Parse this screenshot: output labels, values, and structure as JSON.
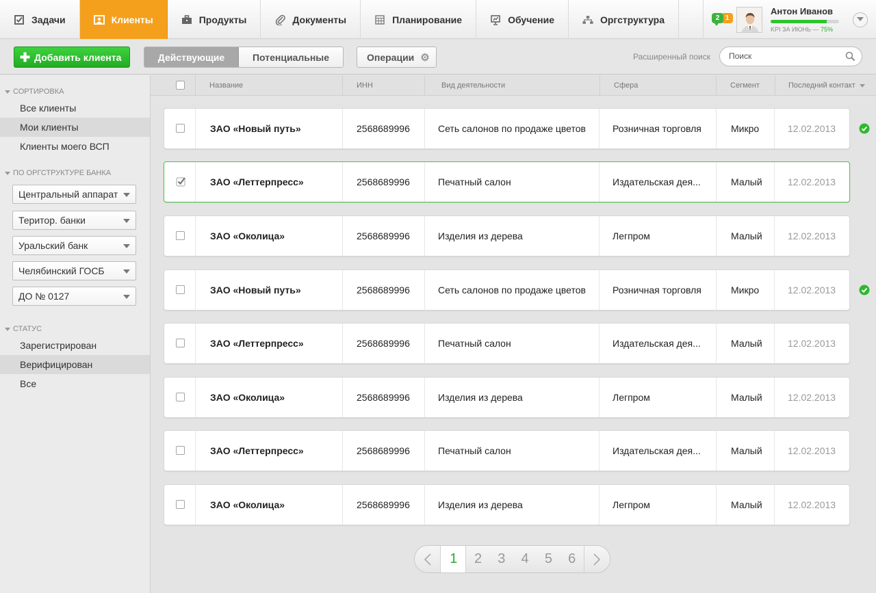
{
  "nav": {
    "tabs": [
      {
        "label": "Задачи",
        "icon": "checkbox-icon"
      },
      {
        "label": "Клиенты",
        "icon": "contacts-icon"
      },
      {
        "label": "Продукты",
        "icon": "briefcase-icon"
      },
      {
        "label": "Документы",
        "icon": "paperclip-icon"
      },
      {
        "label": "Планирование",
        "icon": "calendar-icon"
      },
      {
        "label": "Обучение",
        "icon": "presentation-icon"
      },
      {
        "label": "Оргструктура",
        "icon": "org-chart-icon"
      }
    ],
    "active_tab": "Клиенты",
    "badges": {
      "green": "2",
      "orange": "1"
    },
    "profile": {
      "name": "Антон Иванов",
      "kpi_label": "KPI за июнь —",
      "kpi_value": "75%",
      "kpi_progress": 0.82
    }
  },
  "toolbar": {
    "add_label": "Добавить клиента",
    "seg_active": "Действующие",
    "seg_potential": "Потенциальные",
    "operations_label": "Операции",
    "advanced_search": "Расширенный поиск",
    "search_placeholder": "Поиск"
  },
  "sidebar": {
    "sort_header": "Сортировка",
    "sort_items": [
      "Все клиенты",
      "Мои клиенты",
      "Клиенты моего ВСП"
    ],
    "sort_selected": "Мои клиенты",
    "org_header": "По оргструктуре банка",
    "org_selects": [
      "Центральный аппарат",
      "Територ. банки",
      "Уральский банк",
      "Челябинский ГОСБ",
      "ДО № 0127"
    ],
    "status_header": "Статус",
    "status_items": [
      "Зарегистрирован",
      "Верифицирован",
      "Все"
    ],
    "status_selected": "Верифицирован"
  },
  "table": {
    "columns": {
      "name": "Название",
      "inn": "ИНН",
      "activity": "Вид деятельности",
      "sphere": "Сфера",
      "segment": "Сегмент",
      "last_contact": "Последний контакт"
    },
    "rows": [
      {
        "name": "ЗАО «Новый путь»",
        "inn": "2568689996",
        "activity": "Сеть салонов по продаже цветов",
        "sphere": "Розничная торговля",
        "segment": "Микро",
        "date": "12.02.2013",
        "checked": false,
        "verified": true
      },
      {
        "name": "ЗАО «Леттерпресс»",
        "inn": "2568689996",
        "activity": "Печатный салон",
        "sphere": "Издательская дея...",
        "segment": "Малый",
        "date": "12.02.2013",
        "checked": true,
        "verified": false
      },
      {
        "name": "ЗАО «Околица»",
        "inn": "2568689996",
        "activity": "Изделия из дерева",
        "sphere": "Легпром",
        "segment": "Малый",
        "date": "12.02.2013",
        "checked": false,
        "verified": false
      },
      {
        "name": "ЗАО «Новый путь»",
        "inn": "2568689996",
        "activity": "Сеть салонов по продаже цветов",
        "sphere": "Розничная торговля",
        "segment": "Микро",
        "date": "12.02.2013",
        "checked": false,
        "verified": true
      },
      {
        "name": "ЗАО «Леттерпресс»",
        "inn": "2568689996",
        "activity": "Печатный салон",
        "sphere": "Издательская дея...",
        "segment": "Малый",
        "date": "12.02.2013",
        "checked": false,
        "verified": false
      },
      {
        "name": "ЗАО «Околица»",
        "inn": "2568689996",
        "activity": "Изделия из дерева",
        "sphere": "Легпром",
        "segment": "Малый",
        "date": "12.02.2013",
        "checked": false,
        "verified": false
      },
      {
        "name": "ЗАО «Леттерпресс»",
        "inn": "2568689996",
        "activity": "Печатный салон",
        "sphere": "Издательская дея...",
        "segment": "Малый",
        "date": "12.02.2013",
        "checked": false,
        "verified": false
      },
      {
        "name": "ЗАО «Околица»",
        "inn": "2568689996",
        "activity": "Изделия из дерева",
        "sphere": "Легпром",
        "segment": "Малый",
        "date": "12.02.2013",
        "checked": false,
        "verified": false
      }
    ]
  },
  "pagination": {
    "pages": [
      "1",
      "2",
      "3",
      "4",
      "5",
      "6"
    ],
    "current": "1"
  },
  "colors": {
    "accent_orange": "#f4a01c",
    "accent_green": "#2ec42e",
    "verified_green": "#2eb82e"
  }
}
